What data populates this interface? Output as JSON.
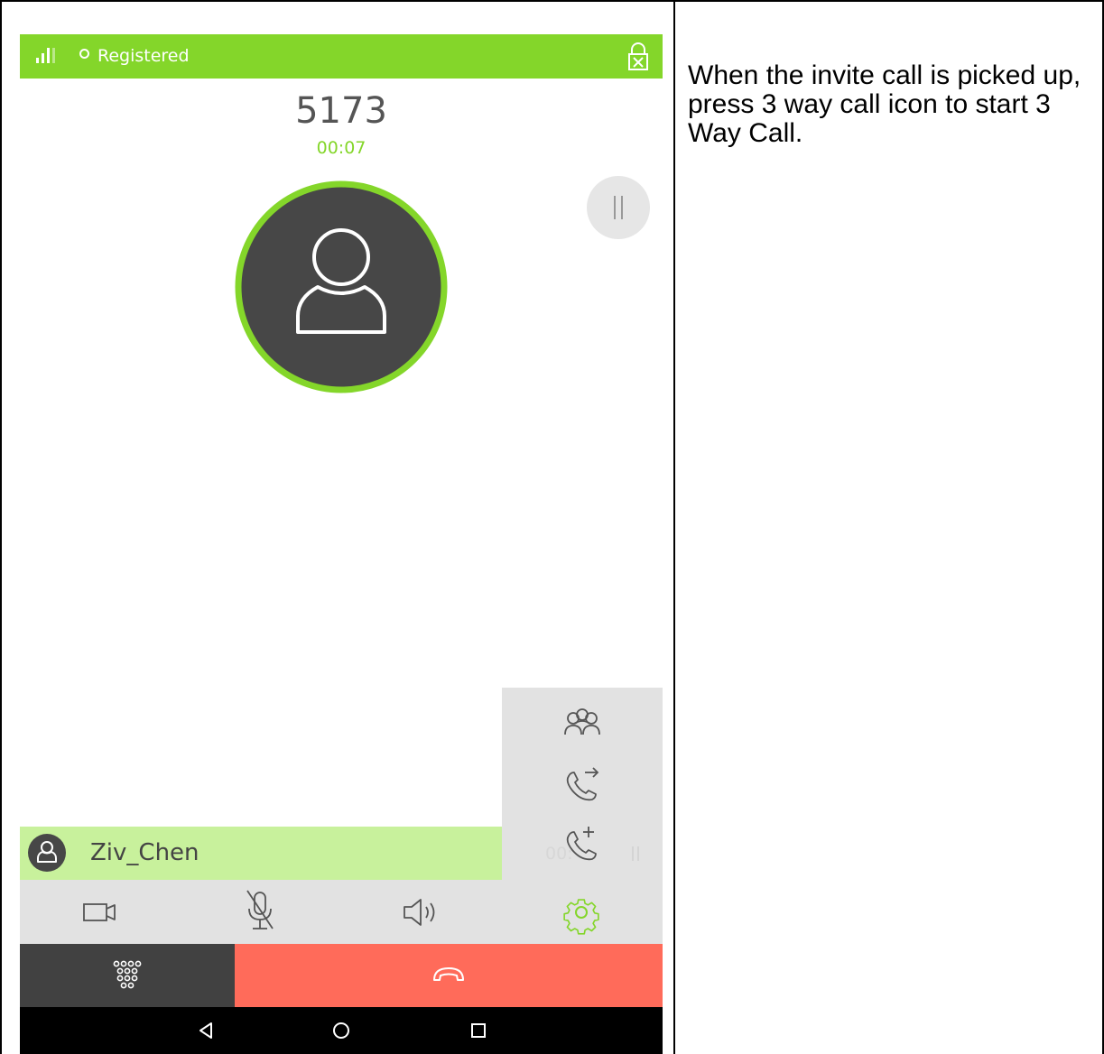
{
  "status_bar": {
    "registration": "Registered",
    "signal_icon": "signal-bars-icon",
    "lock_icon": "lock-icon"
  },
  "call": {
    "number": "5173",
    "duration": "00:07"
  },
  "hold_button": {
    "icon": "pause-icon"
  },
  "more_menu": {
    "items": [
      {
        "icon": "conference-icon"
      },
      {
        "icon": "call-transfer-icon"
      },
      {
        "icon": "add-call-icon"
      }
    ]
  },
  "second_call": {
    "name": "Ziv_Chen",
    "partial_duration": "00:"
  },
  "controls": [
    {
      "icon": "video-icon"
    },
    {
      "icon": "mute-mic-icon"
    },
    {
      "icon": "speaker-icon"
    },
    {
      "icon": "settings-gear-icon"
    }
  ],
  "actions": {
    "keypad_icon": "dialpad-icon",
    "hangup_icon": "hang-up-icon"
  },
  "nav": [
    {
      "icon": "back-icon"
    },
    {
      "icon": "home-icon"
    },
    {
      "icon": "recents-icon"
    }
  ],
  "colors": {
    "accent_green": "#84d62a",
    "light_green": "#c8f19c",
    "hangup_red": "#ff6b5a",
    "avatar_dark": "#474747",
    "control_gray": "#e2e2e2"
  },
  "instruction_text": "When the invite call is picked up, press 3 way call icon to start 3 Way Call."
}
